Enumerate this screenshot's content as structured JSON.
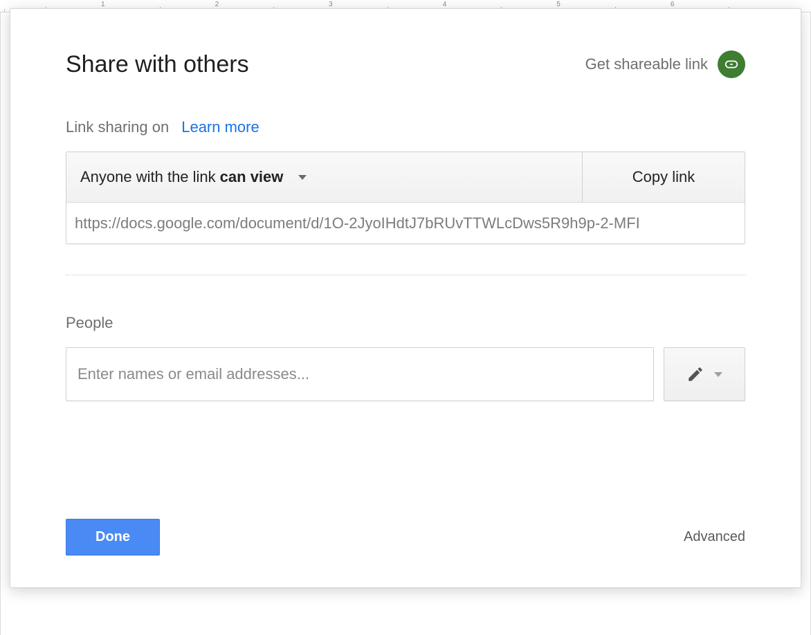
{
  "ruler": {
    "numbers": [
      "1",
      "2",
      "3",
      "4",
      "5",
      "6"
    ]
  },
  "dialog": {
    "title": "Share with others",
    "get_shareable_link": "Get shareable link",
    "link_sharing": {
      "status_label": "Link sharing on",
      "learn_more": "Learn more",
      "permission_prefix": "Anyone with the link ",
      "permission_suffix": "can view",
      "copy_button": "Copy link",
      "url": "https://docs.google.com/document/d/1O-2JyoIHdtJ7bRUvTTWLcDws5R9h9p-2-MFI"
    },
    "people": {
      "label": "People",
      "placeholder": "Enter names or email addresses..."
    },
    "footer": {
      "done": "Done",
      "advanced": "Advanced"
    }
  }
}
